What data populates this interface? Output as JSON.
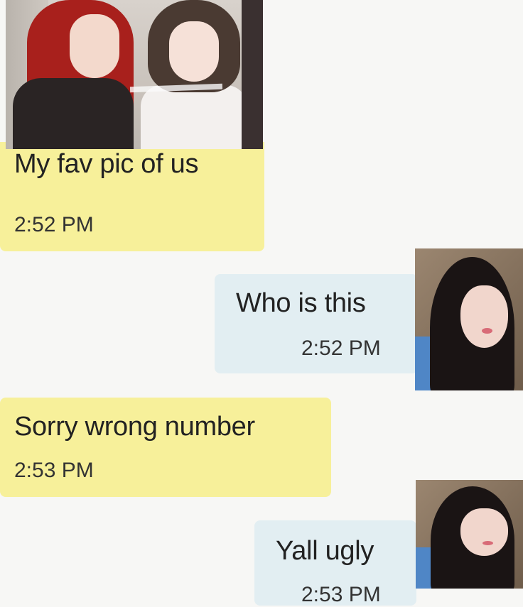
{
  "messages": [
    {
      "type": "received",
      "text": "My fav pic of us",
      "time": "2:52 PM",
      "has_photo": true
    },
    {
      "type": "sent",
      "text": "Who is this",
      "time": "2:52 PM"
    },
    {
      "type": "received",
      "text": "Sorry wrong number",
      "time": "2:53 PM"
    },
    {
      "type": "sent",
      "text": "Yall ugly",
      "time": "2:53 PM"
    }
  ]
}
